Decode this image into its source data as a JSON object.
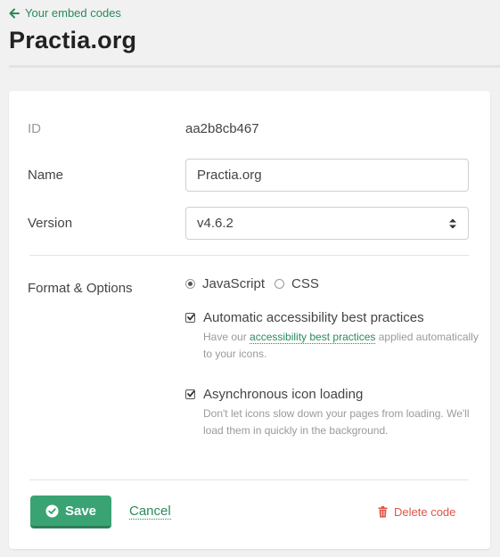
{
  "header": {
    "back_label": "Your embed codes",
    "title": "Practia.org"
  },
  "form": {
    "id_label": "ID",
    "id_value": "aa2b8cb467",
    "name_label": "Name",
    "name_value": "Practia.org",
    "version_label": "Version",
    "version_value": "v4.6.2",
    "format_label": "Format & Options",
    "format_options": [
      {
        "label": "JavaScript",
        "selected": true
      },
      {
        "label": "CSS",
        "selected": false
      }
    ],
    "options": [
      {
        "title": "Automatic accessibility best practices",
        "desc_before": "Have our ",
        "desc_link": "accessibility best practices",
        "desc_after": " applied automatically to your icons.",
        "checked": true
      },
      {
        "title": "Asynchronous icon loading",
        "desc": "Don't let icons slow down your pages from loading. We'll load them in quickly in the background.",
        "checked": true
      }
    ]
  },
  "actions": {
    "save_label": "Save",
    "cancel_label": "Cancel",
    "delete_label": "Delete code"
  },
  "colors": {
    "accent": "#3aa373",
    "link": "#2a8a5c",
    "danger": "#e05547"
  },
  "icons": {
    "back": "arrow-left-icon",
    "select": "sort-icon",
    "save": "check-circle-icon",
    "delete": "trash-icon"
  }
}
